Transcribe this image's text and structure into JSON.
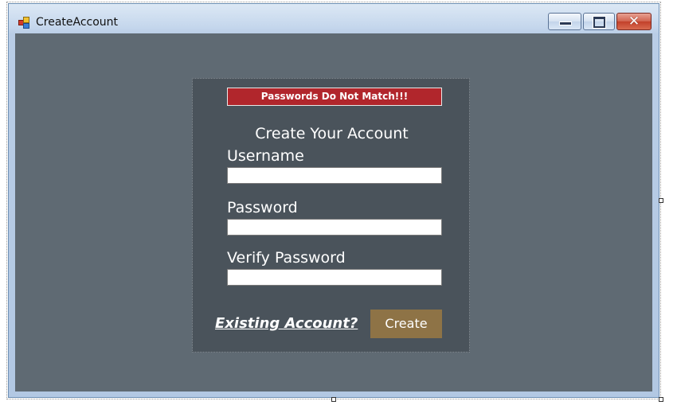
{
  "window": {
    "title": "CreateAccount",
    "icon": "winforms-form-icon",
    "caption_buttons": [
      "minimize-icon",
      "maximize-icon",
      "close-icon"
    ]
  },
  "form": {
    "error_message": "Passwords Do Not Match!!!",
    "heading": "Create Your Account",
    "username": {
      "label": "Username",
      "value": ""
    },
    "password": {
      "label": "Password",
      "value": ""
    },
    "verify_password": {
      "label": "Verify Password",
      "value": ""
    },
    "existing_account_link": "Existing Account?",
    "create_button": "Create"
  },
  "colors": {
    "client_background": "#5f6a73",
    "panel_background": "#4a535b",
    "error_banner": "#b1262c",
    "create_button": "#8e7346",
    "text": "#ffffff"
  }
}
